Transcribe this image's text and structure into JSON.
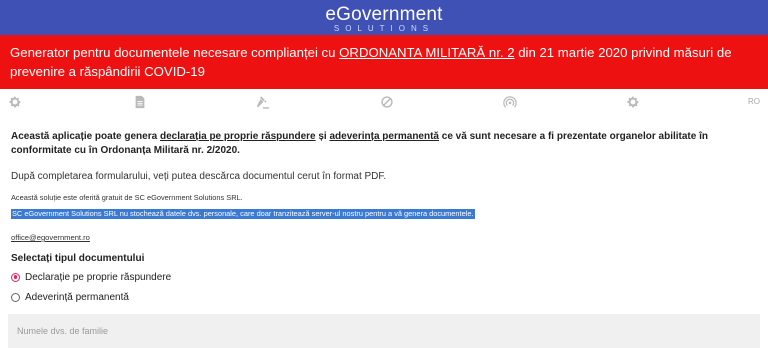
{
  "header": {
    "logo_text": "eGovernment",
    "logo_subtext": "SOLUTIONS"
  },
  "banner": {
    "text_before": "Generator pentru documentele necesare complianței cu ",
    "link_text": "ORDONANTA MILITARĂ nr. 2",
    "text_after": " din 21 martie 2020 privind măsuri de prevenire a răspândirii COVID-19"
  },
  "toolbar": {
    "icons": [
      "gear-icon",
      "document-icon",
      "gavel-icon",
      "prohibited-icon",
      "broadcast-icon",
      "gear-icon"
    ],
    "language": "RO"
  },
  "content": {
    "intro_part1": "Această aplicație poate genera ",
    "intro_link1": "declarația pe proprie răspundere",
    "intro_and": " și ",
    "intro_link2": "adeverința permanentă",
    "intro_part2": " ce vă sunt necesare a fi prezentate organelor abilitate în conformitate cu în Ordonanța Militară nr. 2/2020.",
    "download_text": "După completarea formularului, veți putea descărca documentul cerut în format PDF.",
    "offer_text": "Această soluție este oferită gratuit de SC eGovernment Solutions SRL.",
    "privacy_text": "SC eGovernment Solutions SRL nu stochează datele dvs. personale, care doar tranzitează server-ul nostru pentru a vă genera documentele.",
    "email": "office@egovernment.ro",
    "section_title": "Selectați tipul documentului",
    "options": [
      {
        "label": "Declarație pe proprie răspundere",
        "selected": true
      },
      {
        "label": "Adeverință permanentă",
        "selected": false
      }
    ],
    "name_placeholder": "Numele dvs. de familie",
    "name_value": ""
  },
  "colors": {
    "header_bg": "#3f51b5",
    "banner_bg": "#ee1111",
    "radio_accent": "#e91e63",
    "selection_highlight": "#3a7ad5"
  }
}
